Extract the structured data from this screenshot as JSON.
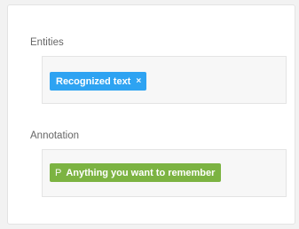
{
  "entities": {
    "label": "Entities",
    "tags": [
      {
        "text": "Recognized text",
        "remove_symbol": "×",
        "color": "#2ea3f2"
      }
    ]
  },
  "annotation": {
    "label": "Annotation",
    "tags": [
      {
        "prefix": "P",
        "text": "Anything you want to remember",
        "color": "#7cb342"
      }
    ]
  }
}
